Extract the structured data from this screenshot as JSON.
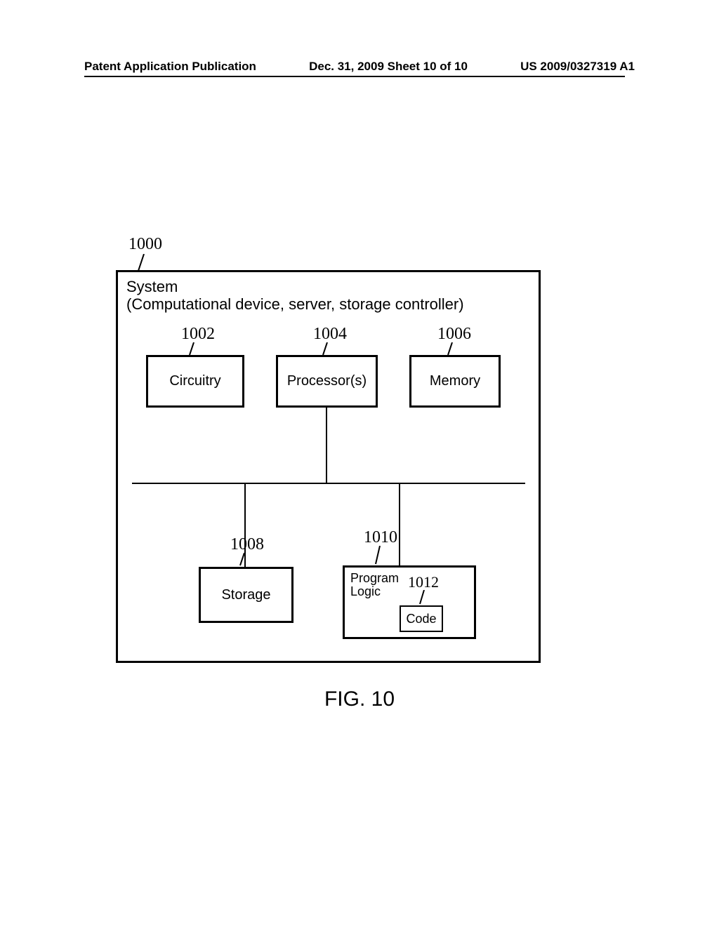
{
  "header": {
    "left": "Patent Application Publication",
    "center": "Dec. 31, 2009  Sheet 10 of 10",
    "right": "US 2009/0327319 A1"
  },
  "refs": {
    "r1000": "1000",
    "r1002": "1002",
    "r1004": "1004",
    "r1006": "1006",
    "r1008": "1008",
    "r1010": "1010",
    "r1012": "1012"
  },
  "labels": {
    "system_line1": "System",
    "system_line2": "(Computational device, server, storage controller)",
    "circuitry": "Circuitry",
    "processors": "Processor(s)",
    "memory": "Memory",
    "storage": "Storage",
    "program_logic_l1": "Program",
    "program_logic_l2": "Logic",
    "code": "Code"
  },
  "caption": "FIG. 10"
}
